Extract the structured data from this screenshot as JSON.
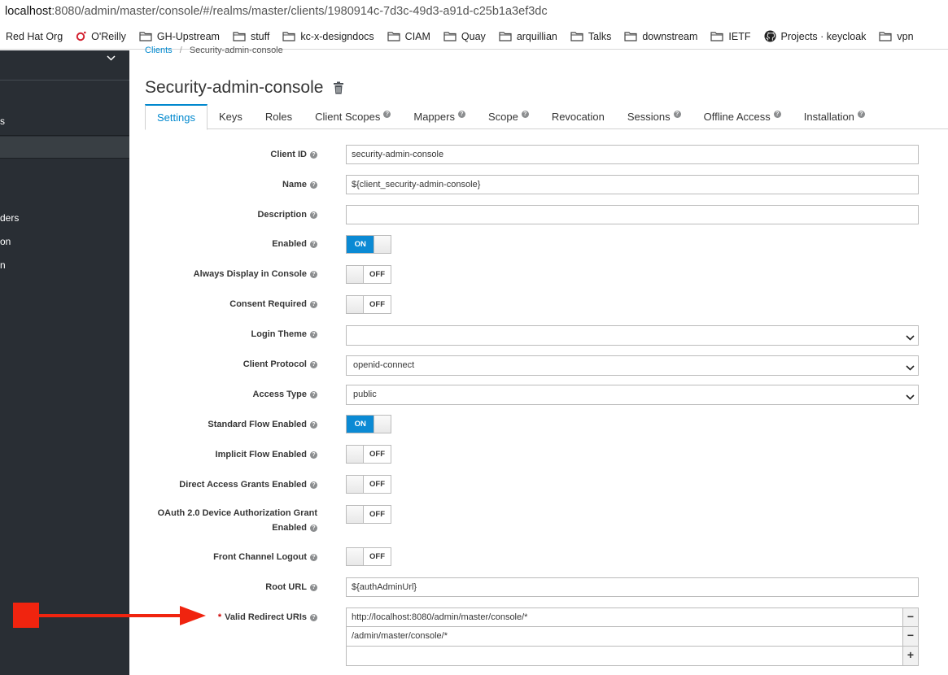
{
  "browser": {
    "url_host": "localhost",
    "url_path": ":8080/admin/master/console/#/realms/master/clients/1980914c-7d3c-49d3-a91d-c25b1a3ef3dc",
    "bookmarks": [
      {
        "label": "Red Hat Org",
        "icon": "none"
      },
      {
        "label": "O'Reilly",
        "icon": "oreilly-icon"
      },
      {
        "label": "GH-Upstream",
        "icon": "folder-icon"
      },
      {
        "label": "stuff",
        "icon": "folder-icon"
      },
      {
        "label": "kc-x-designdocs",
        "icon": "folder-icon"
      },
      {
        "label": "CIAM",
        "icon": "folder-icon"
      },
      {
        "label": "Quay",
        "icon": "folder-icon"
      },
      {
        "label": "arquillian",
        "icon": "folder-icon"
      },
      {
        "label": "Talks",
        "icon": "folder-icon"
      },
      {
        "label": "downstream",
        "icon": "folder-icon"
      },
      {
        "label": "IETF",
        "icon": "folder-icon"
      },
      {
        "label": "Projects · keycloak",
        "icon": "github-icon"
      },
      {
        "label": "vpn",
        "icon": "folder-icon"
      }
    ]
  },
  "sidebar": {
    "items": [
      {
        "label": "s"
      },
      {
        "label": "ders"
      },
      {
        "label": "on"
      },
      {
        "label": "n"
      }
    ]
  },
  "breadcrumb": {
    "parent": "Clients",
    "current": "Security-admin-console"
  },
  "page_title": "Security-admin-console",
  "tabs": [
    {
      "label": "Settings",
      "help": false,
      "active": true
    },
    {
      "label": "Keys",
      "help": false
    },
    {
      "label": "Roles",
      "help": false
    },
    {
      "label": "Client Scopes",
      "help": true
    },
    {
      "label": "Mappers",
      "help": true
    },
    {
      "label": "Scope",
      "help": true
    },
    {
      "label": "Revocation",
      "help": false
    },
    {
      "label": "Sessions",
      "help": true
    },
    {
      "label": "Offline Access",
      "help": true
    },
    {
      "label": "Installation",
      "help": true
    }
  ],
  "form": {
    "client_id": {
      "label": "Client ID",
      "value": "security-admin-console"
    },
    "name": {
      "label": "Name",
      "value": "${client_security-admin-console}"
    },
    "description": {
      "label": "Description",
      "value": ""
    },
    "enabled": {
      "label": "Enabled",
      "state": "ON"
    },
    "always_display": {
      "label": "Always Display in Console",
      "state": "OFF"
    },
    "consent_required": {
      "label": "Consent Required",
      "state": "OFF"
    },
    "login_theme": {
      "label": "Login Theme",
      "value": ""
    },
    "client_protocol": {
      "label": "Client Protocol",
      "value": "openid-connect"
    },
    "access_type": {
      "label": "Access Type",
      "value": "public"
    },
    "standard_flow": {
      "label": "Standard Flow Enabled",
      "state": "ON"
    },
    "implicit_flow": {
      "label": "Implicit Flow Enabled",
      "state": "OFF"
    },
    "direct_access": {
      "label": "Direct Access Grants Enabled",
      "state": "OFF"
    },
    "device_auth": {
      "label_line1": "OAuth 2.0 Device Authorization Grant",
      "label_line2": "Enabled",
      "state": "OFF"
    },
    "front_channel": {
      "label": "Front Channel Logout",
      "state": "OFF"
    },
    "root_url": {
      "label": "Root URL",
      "value": "${authAdminUrl}"
    },
    "redirect_uris": {
      "label": "Valid Redirect URIs",
      "required_mark": "*",
      "values": [
        "http://localhost:8080/admin/master/console/*",
        "/admin/master/console/*",
        ""
      ]
    }
  },
  "help_glyph": "?",
  "annotation_color": "#f0240f"
}
